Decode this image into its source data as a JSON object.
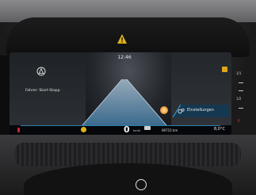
{
  "status": {
    "time": "12:46",
    "driver_message": "Fahrer: Start-Stopp",
    "settings_label": "Einstellungen"
  },
  "cluster": {
    "speed": "0",
    "speed_unit": "km/h",
    "odometer": "06715 km",
    "temperature": "8,0°C"
  },
  "gear_scale": [
    "1/1",
    "1/2",
    "R"
  ],
  "colors": {
    "accent_blue": "#2d7fae",
    "warning_amber": "#e0b21c",
    "warning_red": "#c62a2a"
  },
  "icons": [
    "warning-triangle-icon",
    "autohold-icon",
    "settings-car-icon",
    "range-icon",
    "smiley-icon",
    "brand-logo-icon"
  ]
}
